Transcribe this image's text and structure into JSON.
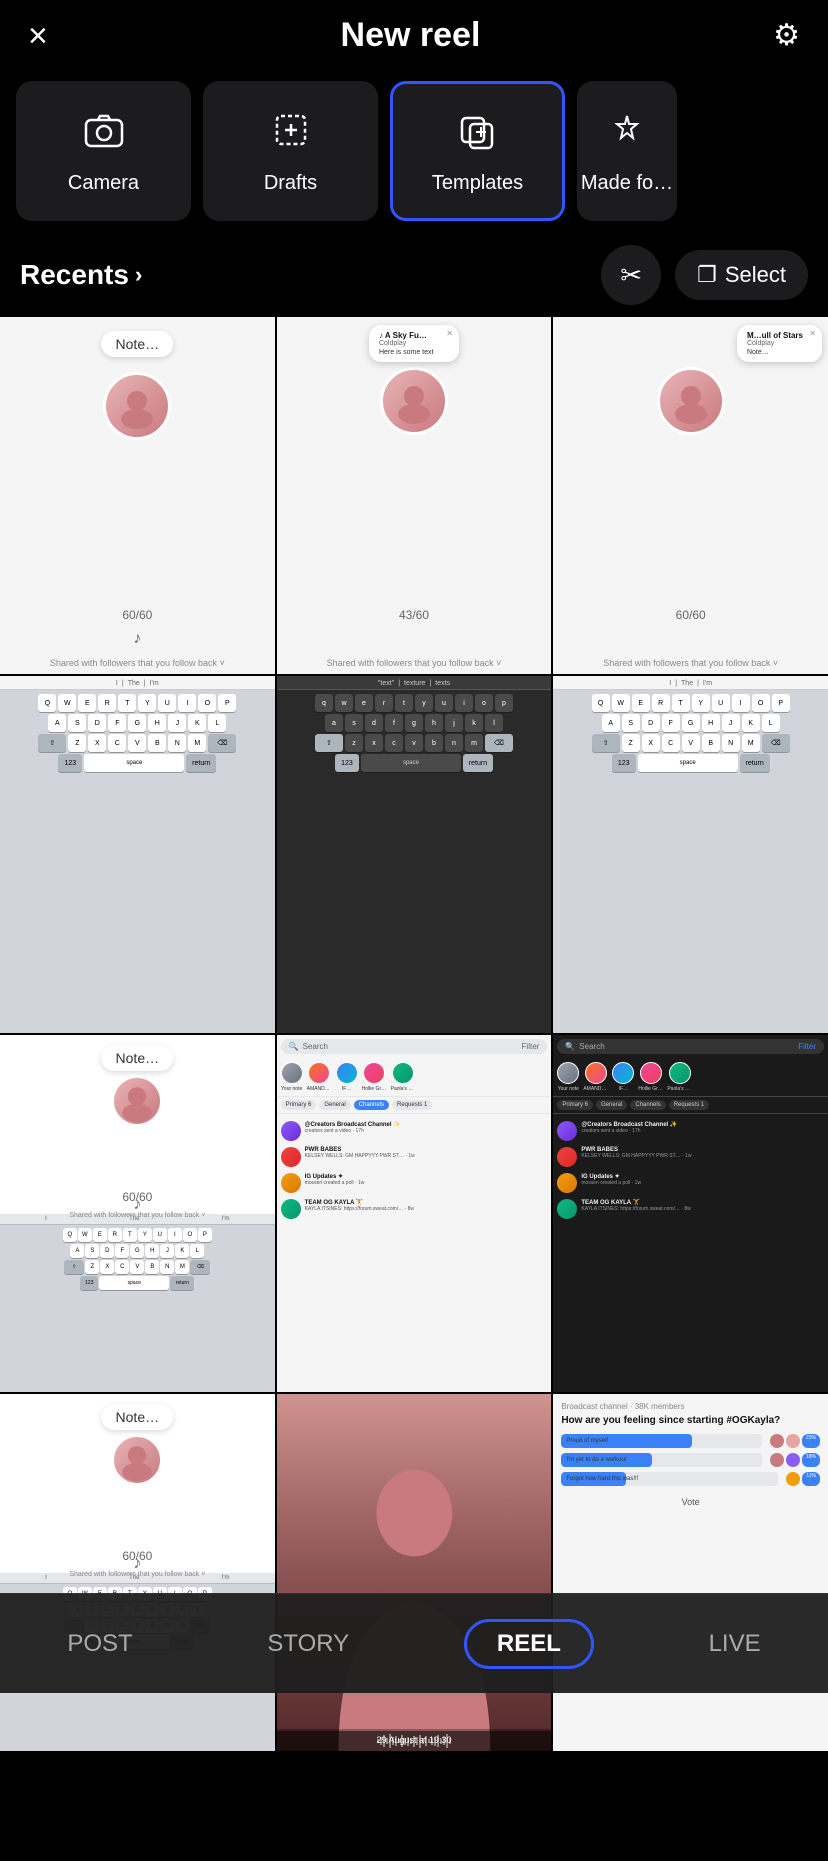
{
  "header": {
    "title": "New reel",
    "close_label": "×",
    "settings_label": "⚙"
  },
  "tabs": [
    {
      "id": "camera",
      "label": "Camera",
      "icon": "📷",
      "active": false
    },
    {
      "id": "drafts",
      "label": "Drafts",
      "icon": "⊕",
      "active": false
    },
    {
      "id": "templates",
      "label": "Templates",
      "icon": "⧉",
      "active": true
    },
    {
      "id": "made-for",
      "label": "Made fo…",
      "icon": "✦",
      "active": false
    }
  ],
  "toolbar": {
    "recents_label": "Recents",
    "select_label": "Select",
    "scissors_icon": "✂",
    "copy_icon": "❐"
  },
  "grid": {
    "rows": [
      [
        {
          "type": "note",
          "note_text": "Note...",
          "counter": "60/60",
          "has_music": true,
          "shared": "Shared with followers that you follow back"
        },
        {
          "type": "note_popup",
          "song": "A Sky Fu…",
          "artist": "Coldplay",
          "body_text": "Here is some text",
          "counter": "43/60",
          "shared": "Shared with followers that you follow back"
        },
        {
          "type": "note_popup2",
          "song": "M…ull of Stars",
          "artist": "Coldplay",
          "note_text": "Note...",
          "counter": "60/60",
          "shared": "Shared with followers that you follow back"
        }
      ],
      [
        {
          "type": "keyboard",
          "suggestions": [
            "I",
            "The",
            "I'm"
          ],
          "keys_row1": [
            "Q",
            "W",
            "E",
            "R",
            "T",
            "Y",
            "U",
            "I",
            "O",
            "P"
          ],
          "keys_row2": [
            "A",
            "S",
            "D",
            "F",
            "G",
            "H",
            "J",
            "K",
            "L"
          ],
          "keys_row3": [
            "Z",
            "X",
            "C",
            "V",
            "B",
            "N",
            "M"
          ]
        },
        {
          "type": "keyboard_dark",
          "suggestions": [
            "\"text\"",
            "texture",
            "texts"
          ]
        },
        {
          "type": "keyboard",
          "suggestions": [
            "I",
            "The",
            "I'm"
          ]
        }
      ],
      [
        {
          "type": "note_keyboard",
          "note_text": "Note...",
          "counter": "60/60",
          "has_music": true,
          "shared": "Shared with followers that you follow back"
        },
        {
          "type": "chat",
          "search_placeholder": "Search",
          "filter": "Filter",
          "tabs": [
            "Primary 6",
            "General",
            "Channels",
            "Requests 1"
          ]
        },
        {
          "type": "chat_dark",
          "search_placeholder": "Search",
          "filter": "Filter",
          "tabs": [
            "Primary 6",
            "General",
            "Channels",
            "Requests 1"
          ]
        }
      ],
      [
        {
          "type": "note_keyboard2",
          "note_text": "Note...",
          "counter": "60/60"
        },
        {
          "type": "photo_person",
          "timestamp": "29 August at 19:30"
        },
        {
          "type": "poll",
          "question": "How are you feeling since starting #OGKayla?",
          "options": [
            "Proud of myself",
            "I'm yet to do a workout",
            "Forgot how hard this was!!!"
          ],
          "vote_label": "Vote"
        }
      ]
    ]
  },
  "bottom_nav": {
    "items": [
      {
        "id": "post",
        "label": "POST",
        "active": false
      },
      {
        "id": "story",
        "label": "STORY",
        "active": false
      },
      {
        "id": "reel",
        "label": "REEL",
        "active": true
      },
      {
        "id": "live",
        "label": "LIVE",
        "active": false
      }
    ]
  },
  "colors": {
    "accent": "#3355ff",
    "active_tab_border": "#3355ff",
    "bg": "#000000",
    "thumb_bg": "#f5f5f5",
    "keyboard_bg": "#d1d5db",
    "poll_bar_purple": "#8b5cf6",
    "poll_bar_blue": "#3b82f6",
    "chat_tab_blue": "#3b82f6"
  }
}
